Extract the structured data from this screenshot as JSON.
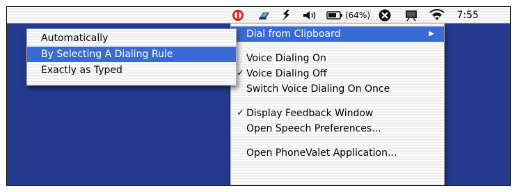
{
  "menubar": {
    "battery_percent": "(64%)",
    "clock": "7:55",
    "icons": [
      "phonevalet-icon",
      "modem-icon",
      "script-icon",
      "volume-icon",
      "battery-icon",
      "x11-icon",
      "display-icon",
      "wifi-icon"
    ]
  },
  "main_menu": {
    "items": [
      {
        "label": "Dial from Clipboard",
        "selected": true,
        "submenu": true
      },
      {
        "label": "Voice Dialing On",
        "checked": false
      },
      {
        "label": "Voice Dialing Off",
        "checked": true
      },
      {
        "label": "Switch Voice Dialing On Once",
        "checked": false
      },
      {
        "label": "Display Feedback Window",
        "checked": true
      },
      {
        "label": "Open Speech Preferences...",
        "checked": false
      },
      {
        "label": "Open PhoneValet Application...",
        "checked": false
      }
    ]
  },
  "submenu": {
    "items": [
      {
        "label": "Automatically",
        "selected": false
      },
      {
        "label": "By Selecting A Dialing Rule",
        "selected": true
      },
      {
        "label": "Exactly as Typed",
        "selected": false
      }
    ]
  },
  "symbols": {
    "check": "✓",
    "submenu_arrow": "▶"
  },
  "colors": {
    "desktop": "#243b8f",
    "selection": "#3a6ad3",
    "phonevalet_red": "#d81b1b"
  }
}
